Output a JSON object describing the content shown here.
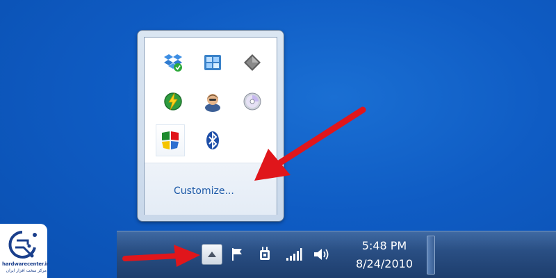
{
  "flyout": {
    "customize_label": "Customize...",
    "icons": [
      {
        "name": "dropbox-icon"
      },
      {
        "name": "window-grid-icon"
      },
      {
        "name": "diamond-icon"
      },
      {
        "name": "lightning-globe-icon"
      },
      {
        "name": "user-avatar-icon"
      },
      {
        "name": "disc-icon"
      },
      {
        "name": "antivirus-shield-icon"
      },
      {
        "name": "bluetooth-icon"
      }
    ]
  },
  "taskbar": {
    "clock_time": "5:48 PM",
    "clock_date": "8/24/2010",
    "tray_icons": [
      "flag-icon",
      "power-plug-icon",
      "signal-icon",
      "volume-icon"
    ]
  },
  "watermark": {
    "brand": "hardwarecenter.ir",
    "tagline": "مرکز سخت افزار ایران"
  },
  "colors": {
    "desktop": "#0f5cc4",
    "arrow": "#e0161b",
    "link": "#1e5aa8"
  }
}
